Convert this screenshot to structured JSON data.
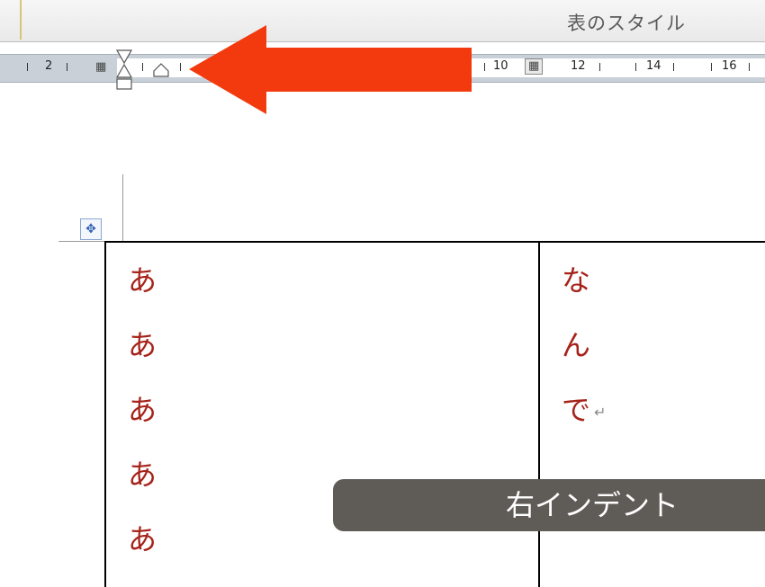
{
  "ribbon": {
    "group_label": "表のスタイル"
  },
  "ruler": {
    "numbers": [
      "2",
      "10",
      "12",
      "14",
      "16"
    ],
    "column_marker": "▦"
  },
  "table": {
    "col1": [
      "あ",
      "あ",
      "あ",
      "あ",
      "あ"
    ],
    "col2": [
      "な",
      "ん",
      "で"
    ],
    "pilcrow": "↵",
    "move_handle": "✥"
  },
  "tooltip": {
    "text": "右インデント"
  },
  "colors": {
    "arrow": "#f33a0e",
    "cell_text": "#a5231a",
    "tooltip_bg": "#5f5b57"
  }
}
